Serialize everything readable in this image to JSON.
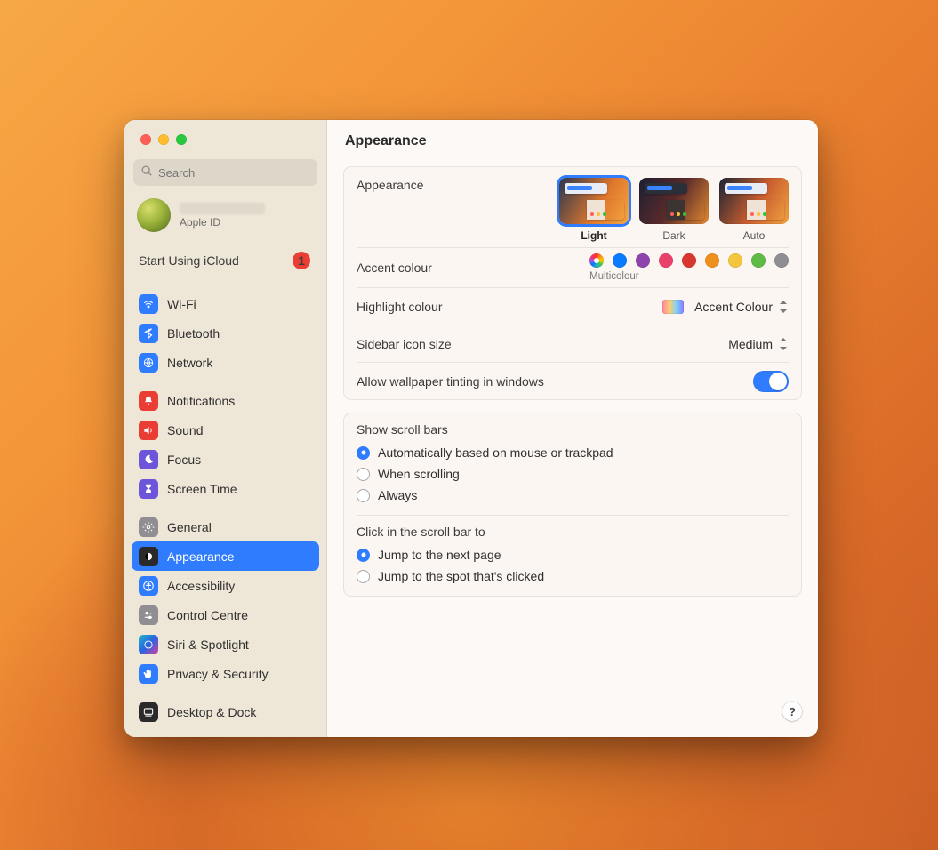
{
  "search": {
    "placeholder": "Search"
  },
  "account": {
    "sub": "Apple ID"
  },
  "icloud": {
    "label": "Start Using iCloud",
    "badge": "1"
  },
  "sidebar": {
    "g1": [
      "Wi-Fi",
      "Bluetooth",
      "Network"
    ],
    "g2": [
      "Notifications",
      "Sound",
      "Focus",
      "Screen Time"
    ],
    "g3": [
      "General",
      "Appearance",
      "Accessibility",
      "Control Centre",
      "Siri & Spotlight",
      "Privacy & Security"
    ],
    "g4": [
      "Desktop & Dock"
    ]
  },
  "header": {
    "title": "Appearance"
  },
  "appearance": {
    "row_label": "Appearance",
    "options": {
      "light": "Light",
      "dark": "Dark",
      "auto": "Auto"
    }
  },
  "accent": {
    "row_label": "Accent colour",
    "caption": "Multicolour",
    "colors": {
      "blue": "#0a7aff",
      "purple": "#8e44ad",
      "pink": "#e9416a",
      "red": "#d9362f",
      "orange": "#ef8f1e",
      "yellow": "#f3c63b",
      "green": "#5fba46",
      "grey": "#8e8e93"
    }
  },
  "highlight": {
    "row_label": "Highlight colour",
    "value": "Accent Colour"
  },
  "sidebar_icon": {
    "row_label": "Sidebar icon size",
    "value": "Medium"
  },
  "tinting": {
    "row_label": "Allow wallpaper tinting in windows",
    "on": true
  },
  "scrollbars": {
    "title": "Show scroll bars",
    "opts": [
      "Automatically based on mouse or trackpad",
      "When scrolling",
      "Always"
    ],
    "selected": 0
  },
  "scrollclick": {
    "title": "Click in the scroll bar to",
    "opts": [
      "Jump to the next page",
      "Jump to the spot that's clicked"
    ],
    "selected": 0
  },
  "help": "?"
}
